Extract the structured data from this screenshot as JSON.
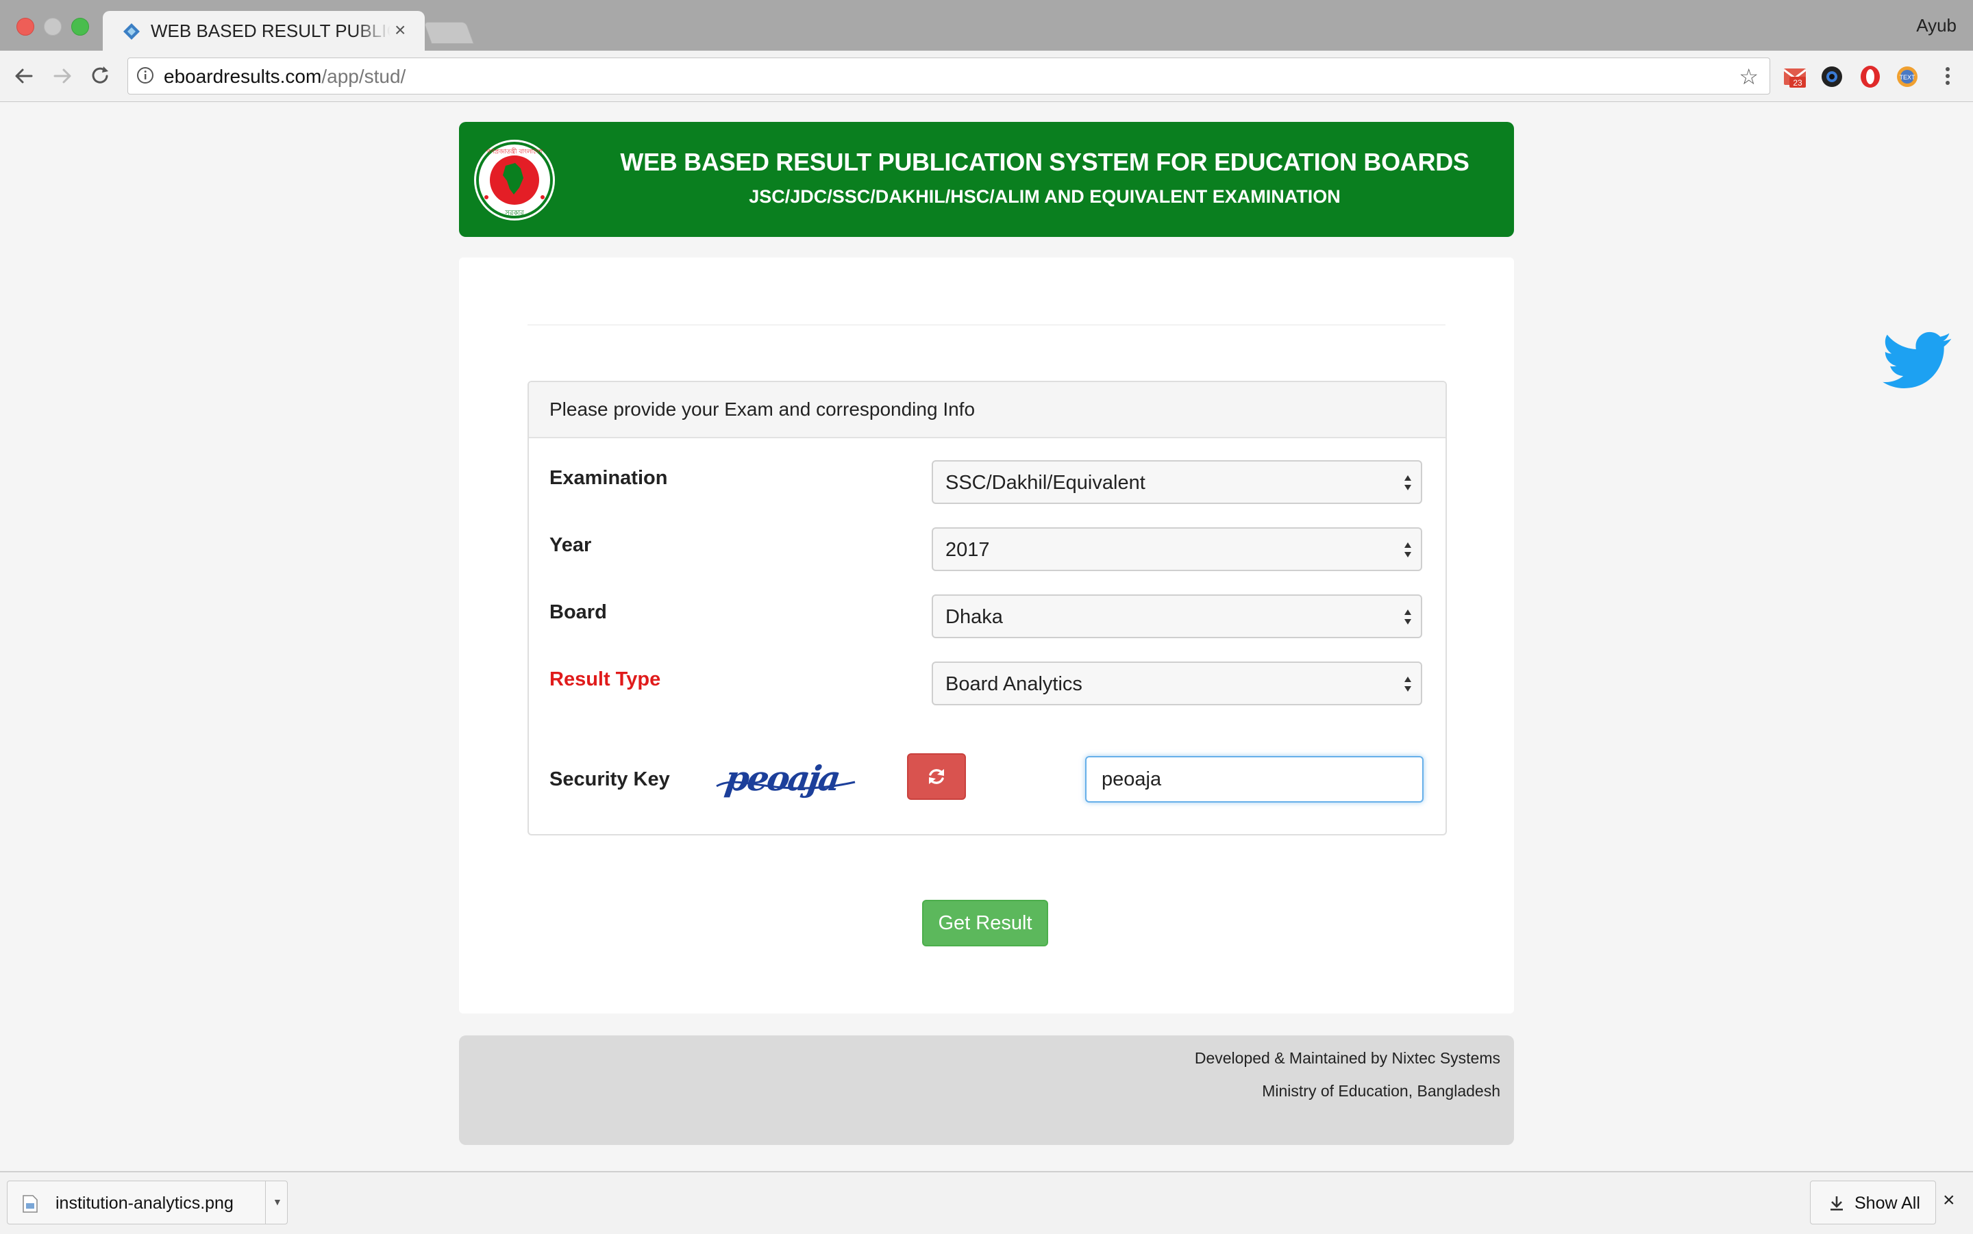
{
  "browser": {
    "tab_title": "WEB BASED RESULT PUBLICATION SYSTEM FOR EDUCATION BOARDS",
    "tab_close": "×",
    "profile_name": "Ayub",
    "url_domain": "eboardresults.com",
    "url_path": "/app/stud/",
    "bookmark_star": "☆",
    "extensions": [
      {
        "name": "gmail-badge",
        "badge": "23"
      },
      {
        "name": "camera"
      },
      {
        "name": "opera"
      },
      {
        "name": "text-extension",
        "label": "TEXT"
      }
    ]
  },
  "header": {
    "title": "WEB BASED RESULT PUBLICATION SYSTEM FOR EDUCATION BOARDS",
    "subtitle": "JSC/JDC/SSC/DAKHIL/HSC/ALIM AND EQUIVALENT EXAMINATION",
    "logo_text_top": "গণপ্রজাতন্ত্রী বাংলাদেশ",
    "logo_text_bottom": "সরকার"
  },
  "form": {
    "heading": "Please provide your Exam and corresponding Info",
    "examination": {
      "label": "Examination",
      "value": "SSC/Dakhil/Equivalent"
    },
    "year": {
      "label": "Year",
      "value": "2017"
    },
    "board": {
      "label": "Board",
      "value": "Dhaka"
    },
    "result_type": {
      "label": "Result Type",
      "value": "Board Analytics"
    },
    "security_key": {
      "label": "Security Key",
      "captcha_text": "peoaja",
      "input_value": "peoaja"
    },
    "submit_label": "Get Result"
  },
  "footer": {
    "line1": "Developed & Maintained by Nixtec Systems",
    "line2": "Ministry of Education, Bangladesh"
  },
  "download_bar": {
    "file_name": "institution-analytics.png",
    "show_all_label": "Show All",
    "close": "×"
  },
  "colors": {
    "header_green": "#0a7f1f",
    "result_type_red": "#e01b1b",
    "refresh_red": "#d9534f",
    "submit_green": "#5cb85c",
    "twitter_blue": "#1da1f2"
  }
}
